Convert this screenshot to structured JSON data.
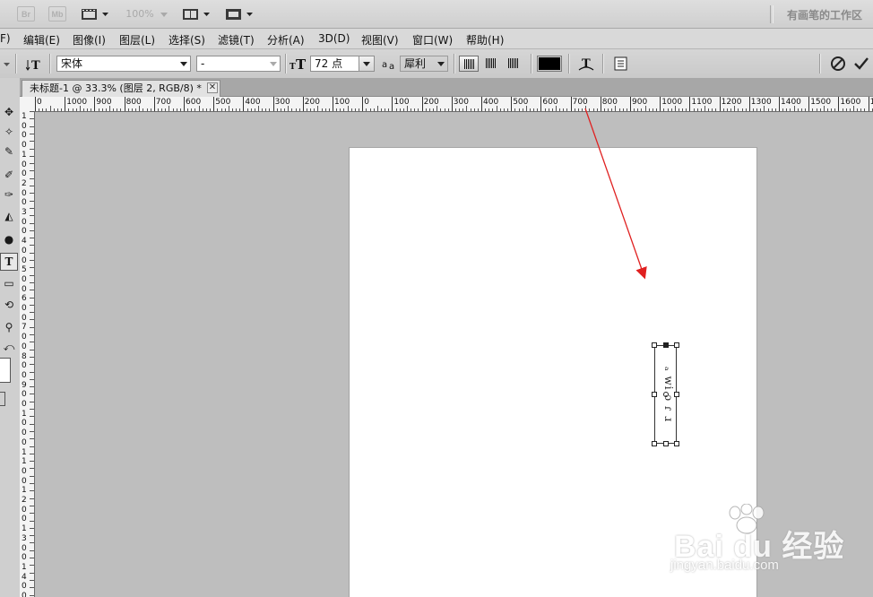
{
  "appbar": {
    "workspace_label": "有画笔的工作区",
    "zoom": "100%",
    "bridge_label": "Br",
    "minibridge_label": "Mb"
  },
  "menu": [
    "F)",
    "编辑(E)",
    "图像(I)",
    "图层(L)",
    "选择(S)",
    "滤镜(T)",
    "分析(A)",
    "3D(D)",
    "视图(V)",
    "窗口(W)",
    "帮助(H)"
  ],
  "options": {
    "font_family": "宋体",
    "font_style": "-",
    "font_size": "72 点",
    "anti_alias": "犀利",
    "text_color": "#000000"
  },
  "document": {
    "tab_title": "未标题-1 @ 33.3% (图层 2, RGB/8) *",
    "close_glyph": "✕"
  },
  "ruler": {
    "h_labels": [
      "0",
      "1000",
      "900",
      "800",
      "700",
      "600",
      "500",
      "400",
      "300",
      "200",
      "100",
      "0",
      "100",
      "200",
      "300",
      "400",
      "500",
      "600",
      "700",
      "800",
      "900",
      "1000",
      "1100",
      "1200",
      "1300",
      "1400",
      "1500",
      "1600",
      "170"
    ],
    "v_labels": [
      "1",
      "0",
      "0",
      "0",
      "1",
      "0",
      "0",
      "2",
      "0",
      "0",
      "3",
      "0",
      "0",
      "4",
      "0",
      "0",
      "5",
      "0",
      "0",
      "6",
      "0",
      "0",
      "7",
      "0",
      "0",
      "8",
      "0",
      "0",
      "9",
      "0",
      "0",
      "1",
      "0",
      "0",
      "0",
      "1",
      "1",
      "0",
      "0",
      "1",
      "2",
      "0",
      "0",
      "1",
      "3",
      "0",
      "0",
      "1",
      "4",
      "0",
      "0"
    ]
  },
  "canvas": {
    "vertical_text": "ₐ wi ɔ ɾ ɹ",
    "annotation_color": "#e02020"
  },
  "watermark": {
    "main": "Bai du 经验",
    "sub": "jingyan.baidu.com"
  }
}
